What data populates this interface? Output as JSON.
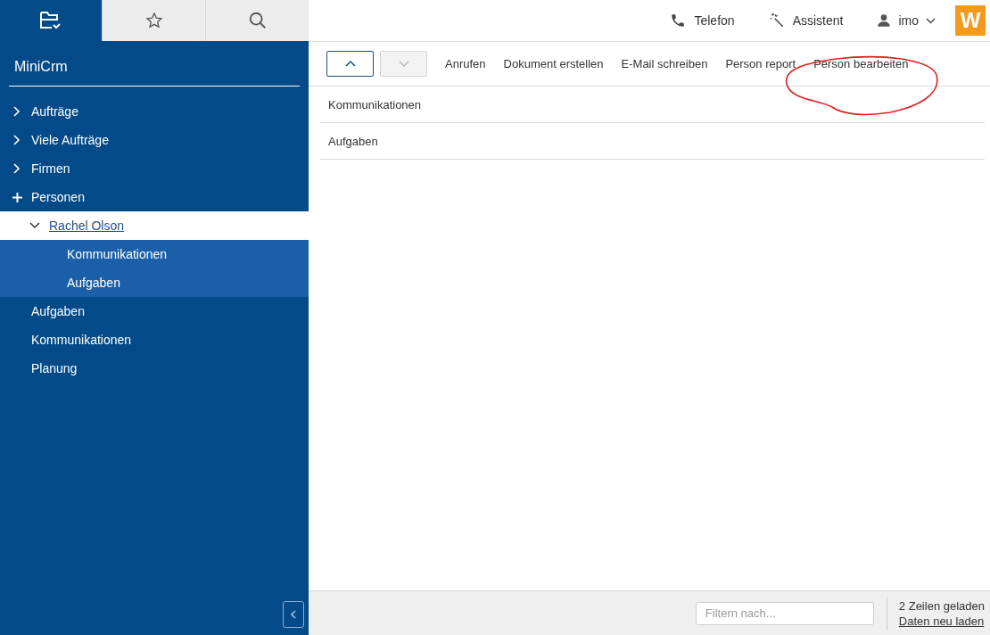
{
  "sidebar": {
    "tabs": [
      {
        "kind": "folder",
        "selected": true
      },
      {
        "kind": "star",
        "selected": false
      },
      {
        "kind": "search",
        "selected": false
      }
    ],
    "title": "MiniCrm",
    "items": [
      {
        "label": "Aufträge",
        "kind": "collapsed",
        "selected": false
      },
      {
        "label": "Viele Aufträge",
        "kind": "collapsed",
        "selected": false
      },
      {
        "label": "Firmen",
        "kind": "collapsed",
        "selected": false
      },
      {
        "label": "Personen",
        "kind": "plus",
        "selected": false,
        "children": [
          {
            "label": "Rachel Olson",
            "kind": "expanded",
            "selected": true,
            "children": [
              {
                "label": "Kommunikationen",
                "kind": "leaf",
                "selected": false
              },
              {
                "label": "Aufgaben",
                "kind": "leaf",
                "selected": false
              }
            ]
          }
        ]
      },
      {
        "label": "Aufgaben",
        "kind": "leaf",
        "selected": false
      },
      {
        "label": "Kommunikationen",
        "kind": "leaf",
        "selected": false
      },
      {
        "label": "Planung",
        "kind": "leaf",
        "selected": false
      }
    ]
  },
  "header": {
    "actions": [
      {
        "kind": "phone",
        "label": "Telefon"
      },
      {
        "kind": "wand",
        "label": "Assistent"
      },
      {
        "kind": "user",
        "label": "imo"
      }
    ],
    "logo": "W"
  },
  "toolbar": {
    "nav_buttons": [
      {
        "kind": "up",
        "disabled": false
      },
      {
        "kind": "down",
        "disabled": true
      }
    ],
    "actions": [
      "Anrufen",
      "Dokument erstellen",
      "E-Mail schreiben",
      "Person report",
      "Person bearbeiten"
    ]
  },
  "annotation": {
    "kind": "circle"
  },
  "rows": [
    "Kommunikationen",
    "Aufgaben"
  ],
  "footer": {
    "filter": {
      "placeholder": "Filtern nach..."
    },
    "status": "2 Zeilen geladen",
    "reload_link": "Daten neu laden"
  }
}
